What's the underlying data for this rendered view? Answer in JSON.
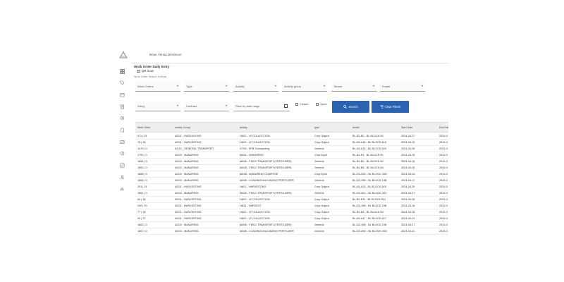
{
  "header": {
    "breadcrumb": "Brian / Brian Dickinson"
  },
  "page": {
    "title": "Work Order Daily Entry",
    "qr_label": "QR Scan",
    "search_criteria_label": "Work Order Search Criteria"
  },
  "sidebar": {
    "icons": [
      "dashboard-icon",
      "tag-icon",
      "calendar-icon",
      "list-icon",
      "settings-icon",
      "document-icon",
      "chart-icon",
      "tool-icon",
      "report-icon",
      "user-icon",
      "analytics-icon"
    ]
  },
  "filters": {
    "work_orders": "Work Orders",
    "type": "Type",
    "activity": "Activity",
    "activity_group": "Activity group",
    "tenant": "Tenant",
    "estate": "Estate",
    "gang": "Gang",
    "contract": "Contract",
    "date_range_placeholder": "Filter by date range",
    "closed_label": "Closed",
    "open_label": "Open",
    "search_button": "Search",
    "clear_button": "Clear Filters"
  },
  "table": {
    "headers": [
      "Work Order",
      "activity Group",
      "activity",
      "type",
      "tender",
      "Start Date",
      "End Dat"
    ],
    "rows": [
      [
        "911 | 34",
        "AG01 - HARVESTING",
        "HA02 - LF COLLECTION",
        "Crop Output",
        "BL-B1-B2 - BL BLOCK B2",
        "2024-04-27",
        "2024-0"
      ],
      [
        "76 | 36",
        "AG01 - HARVESTING",
        "HA02 - LF COLLECTION",
        "Crop Output",
        "BL-A5-A18 - BL BLOCK A18",
        "2024-04-19",
        "2024-0"
      ],
      [
        "1470 | 0",
        "AG10 - GENERAL TRANSPORT",
        "GT09 - EFB Transporting",
        "General",
        "BL-A5-A15 - BL BLOCK A15",
        "2024-04-25",
        "2024-0"
      ],
      [
        "1792 | 0",
        "AG03 - MANURING",
        "MA01 - MANURING",
        "Crop Input",
        "BL-B1-B1 - BL BLOCK B1",
        "2024-04-15",
        "2024-0"
      ],
      [
        "1854 | 0",
        "AG03 - MANURING",
        "MA05 - FIELD TRANSPORT (FERTILIZER)",
        "General",
        "BL-B1-B2 - BL BLOCK B2",
        "2024-04-15",
        "2024-0"
      ],
      [
        "1852 | 0",
        "AG03 - MANURING",
        "MA05 - FIELD TRANSPORT (FERTILIZER)",
        "General",
        "BL-B1-B4 - BL BLOCK B4",
        "2024-04-15",
        "2024-0"
      ],
      [
        "1868 | 0",
        "AG03 - MANURING",
        "MA08 - MANURING COMPOSE",
        "Crop Input",
        "BL-D3-20D - BL BLOCK 20D",
        "2024-04-24",
        "2024-0"
      ],
      [
        "1864 | 0",
        "AG03 - MANURING",
        "MA06 - LOADING/UNLOADING FERTILIZER",
        "General",
        "BL-D2-19B - BL BLOCK 19B",
        "2024-04-17",
        "2024-0"
      ],
      [
        "291 | 31",
        "AG01 - HARVESTING",
        "HA01 - HARVESTING",
        "Crop Output",
        "BL-A5-A15 - BL BLOCK A15",
        "2024-04-29",
        "2024-0"
      ],
      [
        "1861 | 0",
        "AG03 - MANURING",
        "MA05 - FIELD TRANSPORT (FERTILIZER)",
        "General",
        "BL-D3-20C - BL BLOCK 20C",
        "2024-04-17",
        "2024-0"
      ],
      [
        "84 | 38",
        "AG01 - HARVESTING",
        "HA02 - LF COLLECTION",
        "Crop Output",
        "BL-B1-B11 - BL BLOCK B11",
        "2024-04-25",
        "2024-0"
      ],
      [
        "290 | 30",
        "AG01 - HARVESTING",
        "HA01 - HARVEST",
        "Crop Output",
        "BL-D2-19B - BL BLOCK 19B",
        "2024-04-18",
        "2024-0"
      ],
      [
        "77 | 38",
        "AG01 - HARVESTING",
        "HA02 - LF COLLECTION",
        "Crop Output",
        "BL-B1-B4 - BL BLOCK B4",
        "2024-04-28",
        "2024-0"
      ],
      [
        "94 | 37",
        "AG01 - HARVESTING",
        "HA02 - LF COLLECTION",
        "Crop Output",
        "BL-A5-A17 - BL BLOCK A17",
        "2024-04-13",
        "2024-0"
      ],
      [
        "1862 | 0",
        "AG03 - MANURING",
        "MA05 - FIELD TRANSPORT (FERTILIZER)",
        "General",
        "BL-D2-19B - BL BLOCK 19B",
        "2024-04-17",
        "2024-0"
      ],
      [
        "1867 | 0",
        "AG03 - MANURING",
        "MA06 - LOADING/UNLOADING FERTILIZER",
        "General",
        "BL-D3-20D - BL BLOCK 20D",
        "2024-04-21",
        "2024-0"
      ]
    ]
  },
  "colors": {
    "accent": "#2a63b0",
    "header_bg": "#eeeeee"
  }
}
